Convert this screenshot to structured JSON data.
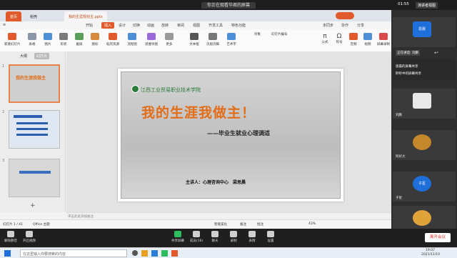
{
  "meeting": {
    "banner": "你正在观看华君的屏幕",
    "time": "01:55",
    "speaker_view": "演讲者视图",
    "participants": [
      {
        "name": "恩晨",
        "color": "#1e6fd9",
        "label": "恩晨"
      },
      {
        "name": "刘鹏",
        "color": "#e8e8e8",
        "label": "刘鹏"
      },
      {
        "name": "阿好大",
        "color": "#c4872a",
        "label": "阿好大"
      },
      {
        "name": "子星",
        "color": "#1e6fd9",
        "label": "子星"
      },
      {
        "name": "",
        "color": "#e0a33a",
        "label": ""
      }
    ],
    "speaking_label": "正在讲话: 刘鹏",
    "side_label_1": "恩晨的屏幕共享",
    "side_label_2": "聆听中的屏幕共享"
  },
  "wps": {
    "tabs": [
      "首页",
      "稻壳",
      "我的生涯规划主.pptx"
    ],
    "ribbon_tabs": [
      "开始",
      "插入",
      "设计",
      "切换",
      "动画",
      "放映",
      "审阅",
      "视图",
      "开发工具",
      "特色功能"
    ],
    "ribbon_active": "插入",
    "ribbon_right": [
      "未同步",
      "协作",
      "分享"
    ],
    "toolbar_buttons": [
      "新建幻灯片",
      "表格",
      "图片",
      "形状",
      "截屏",
      "图标",
      "稻壳资源",
      "流程图",
      "思维导图",
      "更多",
      "文本框",
      "页眉页脚",
      "艺术字",
      "对象",
      "幻灯片编号",
      "公式",
      "符号",
      "音频",
      "视频",
      "屏幕录制"
    ],
    "left_tabs": [
      "大纲",
      "幻灯片"
    ],
    "slide_numbers": [
      "1",
      "2",
      "3"
    ],
    "notes_placeholder": "单击此处添加备注",
    "status": {
      "slide_count": "幻灯片 1 / 41",
      "theme": "Office 主题",
      "notes": "智能美化",
      "comments": "备注",
      "annot": "批注",
      "zoom": "43%"
    }
  },
  "slide": {
    "school": "江西工业贸易职业技术学院",
    "title": "我的生涯我做主！",
    "subtitle": "——毕业生就业心理调适",
    "presenter": "主讲人：心理咨询中心　梁思晨"
  },
  "controls": {
    "items": [
      "解除静音",
      "开启视频",
      "共享屏幕",
      "成员(16)",
      "聊天",
      "录制",
      "表情",
      "设置"
    ],
    "end": "离开会议"
  },
  "taskbar": {
    "search_placeholder": "在这里输入你要搜索的内容",
    "time": "19:07",
    "date": "2021/11/10"
  }
}
